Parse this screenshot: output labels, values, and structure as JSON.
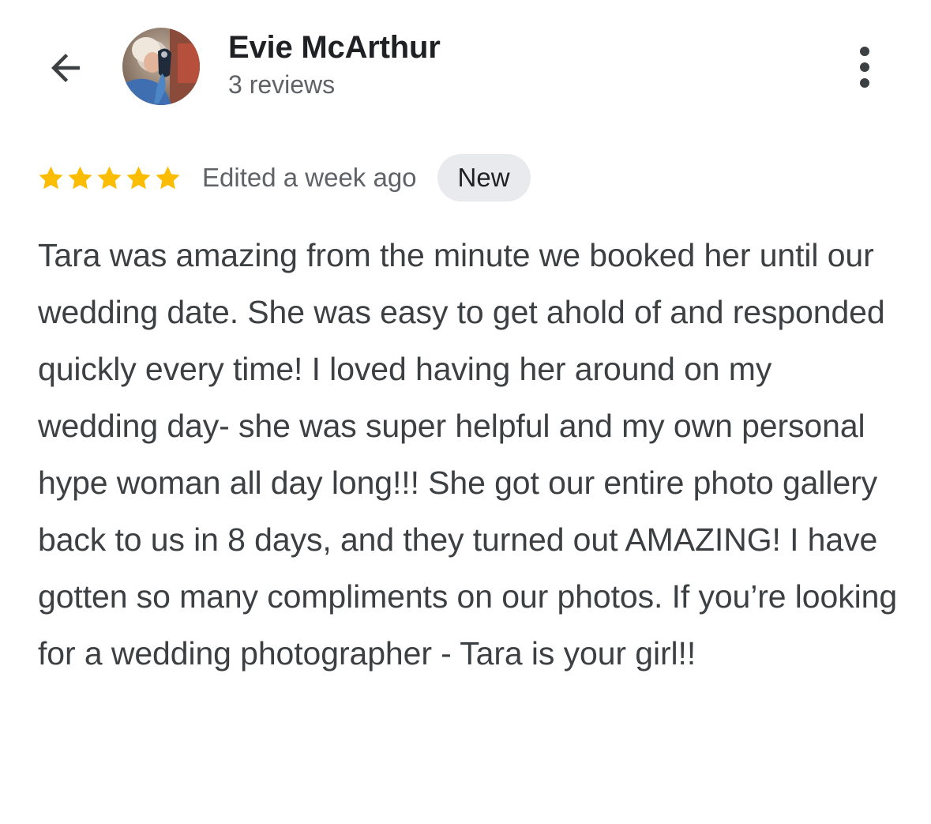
{
  "header": {
    "back_icon": "arrow-left-icon",
    "author_name": "Evie McArthur",
    "review_count": "3 reviews",
    "more_icon": "more-vertical-icon"
  },
  "review": {
    "rating": 5,
    "rating_max": 5,
    "star_color": "#fbbc04",
    "edited_label": "Edited a week ago",
    "badge_label": "New",
    "text": "Tara was amazing from the minute we booked her until our wedding date. She was easy to get ahold of and responded quickly every time! I loved having her around on my wedding day- she was super helpful and my own personal hype woman all day long!!! She got our entire photo gallery back to us in 8 days, and they turned out AMAZING! I have gotten so many compliments on our photos. If you’re looking for a wedding photographer - Tara is your girl!!"
  }
}
